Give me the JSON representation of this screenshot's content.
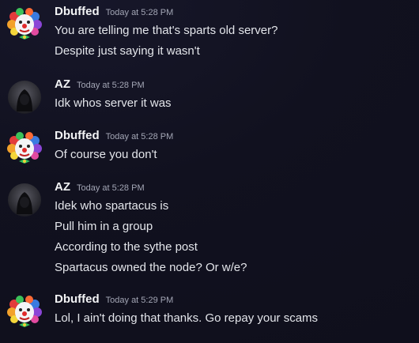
{
  "messages": [
    {
      "author": "Dbuffed",
      "avatar_icon": "clown-avatar-icon",
      "timestamp": "Today at 5:28 PM",
      "lines": [
        "You are telling me that's sparts old server?",
        "Despite just saying it wasn't"
      ]
    },
    {
      "author": "AZ",
      "avatar_icon": "hooded-figure-avatar-icon",
      "timestamp": "Today at 5:28 PM",
      "lines": [
        "Idk whos server it was"
      ]
    },
    {
      "author": "Dbuffed",
      "avatar_icon": "clown-avatar-icon",
      "timestamp": "Today at 5:28 PM",
      "lines": [
        "Of course you don't"
      ]
    },
    {
      "author": "AZ",
      "avatar_icon": "hooded-figure-avatar-icon",
      "timestamp": "Today at 5:28 PM",
      "lines": [
        "Idek who spartacus is",
        "Pull him in a group",
        "According to the sythe post",
        "Spartacus owned the node? Or w/e?"
      ]
    },
    {
      "author": "Dbuffed",
      "avatar_icon": "clown-avatar-icon",
      "timestamp": "Today at 5:29 PM",
      "lines": [
        "Lol, I ain't doing that thanks. Go repay your scams"
      ]
    }
  ]
}
